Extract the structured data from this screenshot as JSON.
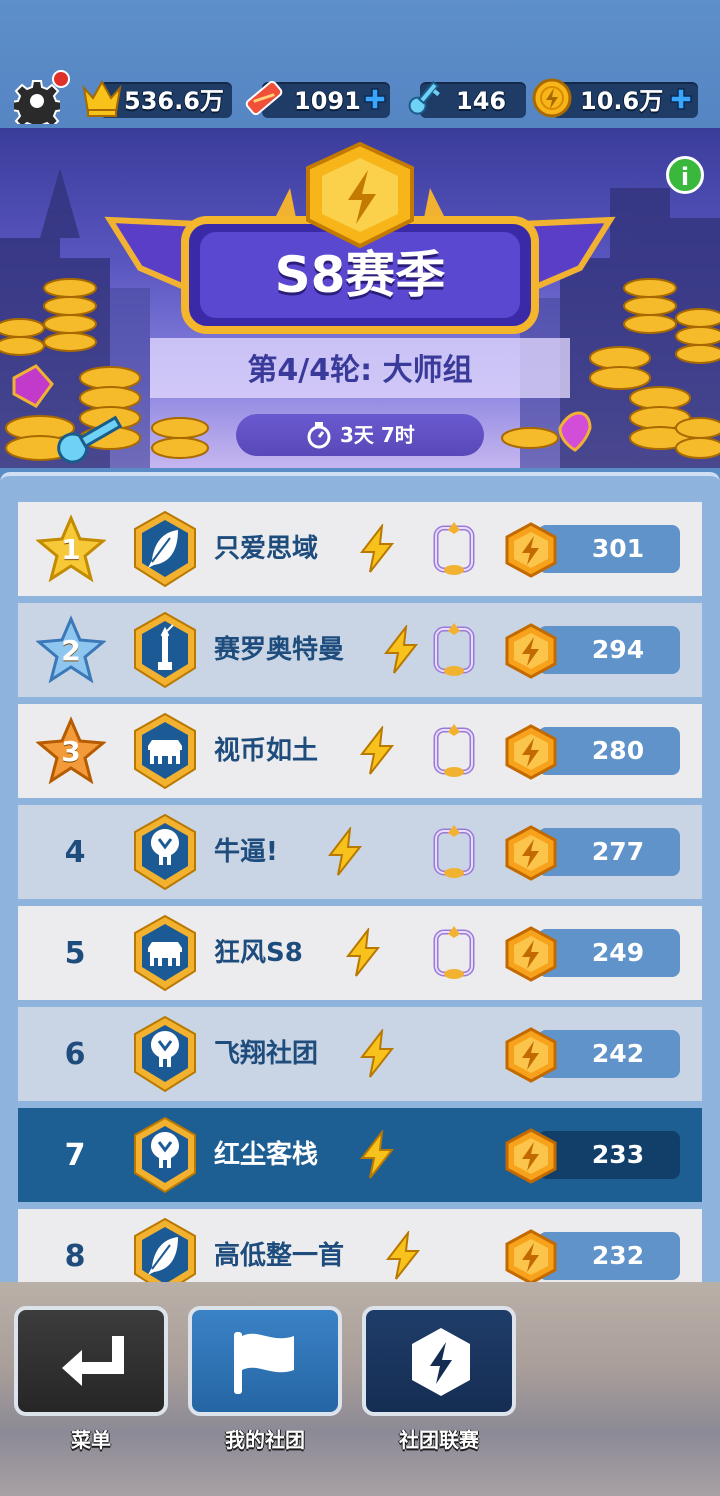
{
  "resources": {
    "crowns": "536.6万",
    "tickets": "1091",
    "keys": "146",
    "coins": "10.6万"
  },
  "banner": {
    "season_title": "S8赛季",
    "round_text": "第4/4轮: 大师组",
    "timer": "3天 7时"
  },
  "ranking": [
    {
      "rank": "1",
      "name": "只爱思域",
      "score": "301",
      "badge": "feather",
      "frame": true
    },
    {
      "rank": "2",
      "name": "赛罗奥特曼",
      "score": "294",
      "badge": "statue",
      "frame": true
    },
    {
      "rank": "3",
      "name": "视币如土",
      "score": "280",
      "badge": "gate",
      "frame": true
    },
    {
      "rank": "4",
      "name": "牛逼!",
      "score": "277",
      "badge": "eagle",
      "frame": true
    },
    {
      "rank": "5",
      "name": "狂风S8",
      "score": "249",
      "badge": "gate",
      "frame": true
    },
    {
      "rank": "6",
      "name": "飞翔社团",
      "score": "242",
      "badge": "eagle",
      "frame": false
    },
    {
      "rank": "7",
      "name": "红尘客栈",
      "score": "233",
      "badge": "eagle",
      "frame": false
    },
    {
      "rank": "8",
      "name": "高低整一首",
      "score": "232",
      "badge": "feather",
      "frame": false
    }
  ],
  "nav": {
    "menu": "菜单",
    "my_club": "我的社团",
    "club_league": "社团联赛"
  },
  "icons": {
    "settings": "gear-icon",
    "crown": "crown-icon",
    "ticket": "ticket-icon",
    "key": "key-icon",
    "coin": "coin-icon",
    "info": "info-icon"
  },
  "colors": {
    "self_row": "#1d5e93",
    "score_bar": "#5f93c9",
    "gold": "#f5a623"
  }
}
